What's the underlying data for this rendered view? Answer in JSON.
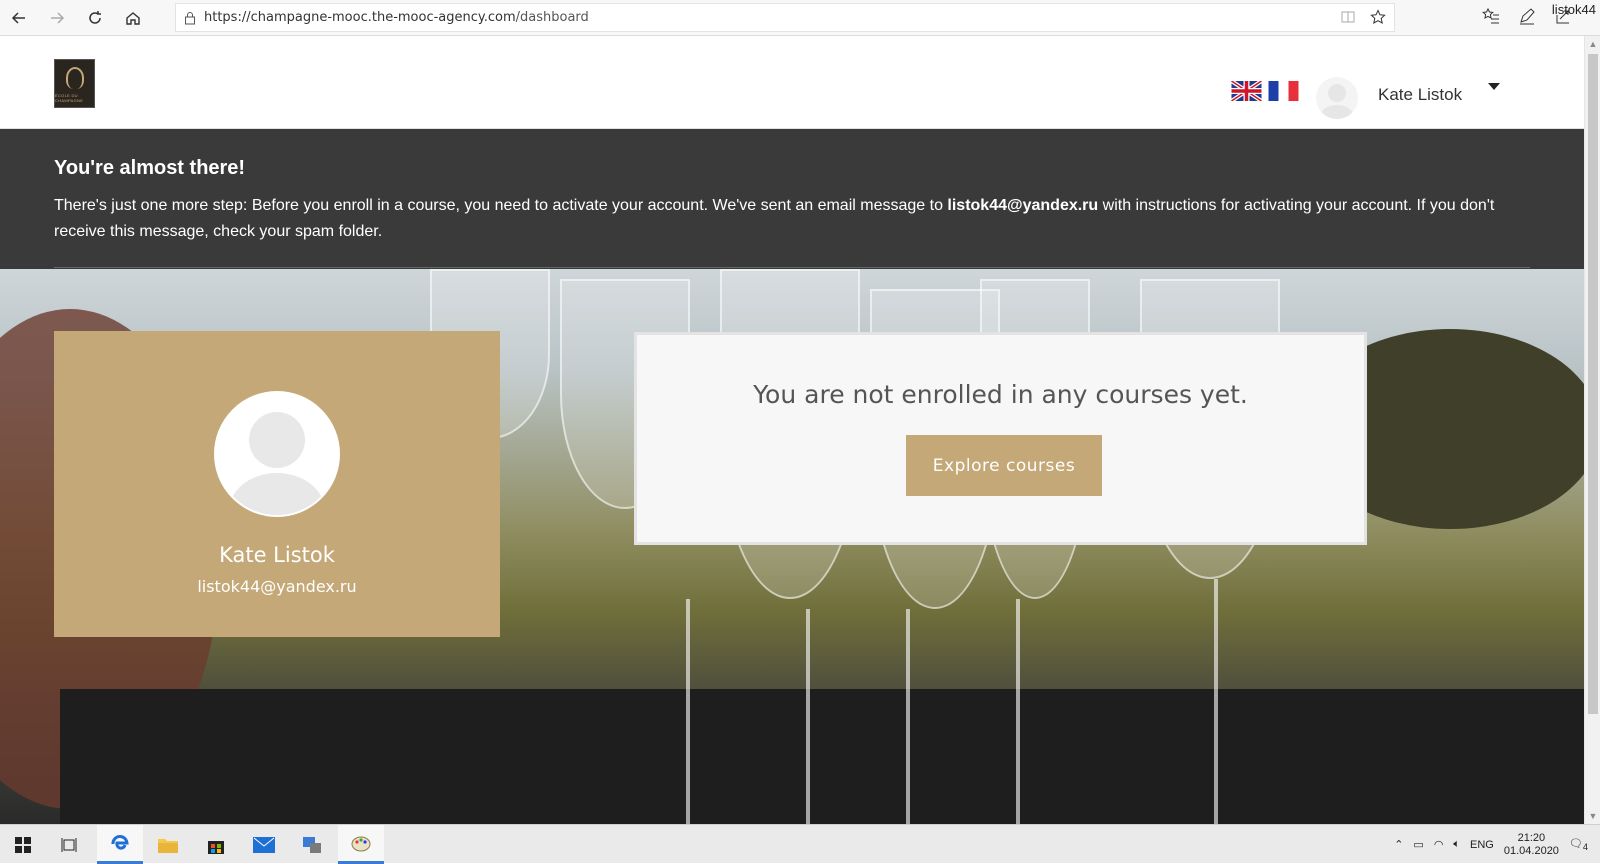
{
  "browser": {
    "url_host": "https://champagne-mooc.the-mooc-agency.com",
    "url_path": "/dashboard",
    "profile_name": "listok44"
  },
  "header": {
    "logo_text": "ÉCOLE DU CHAMPAGNE",
    "user_name": "Kate Listok"
  },
  "notice": {
    "title": "You're almost there!",
    "text_before": "There's just one more step: Before you enroll in a course, you need to activate your account. We've sent an email message to ",
    "email": "listok44@yandex.ru",
    "text_after": " with instructions for activating your account. If you don't receive this message, check your spam folder."
  },
  "profile": {
    "name": "Kate Listok",
    "email": "listok44@yandex.ru"
  },
  "courses": {
    "empty_message": "You are not enrolled in any courses yet.",
    "explore_label": "Explore courses"
  },
  "taskbar": {
    "language": "ENG",
    "time": "21:20",
    "date": "01.04.2020",
    "notification_count": "4"
  },
  "colors": {
    "accent_gold": "#c5a877",
    "notice_bg": "#3a3a3a"
  }
}
